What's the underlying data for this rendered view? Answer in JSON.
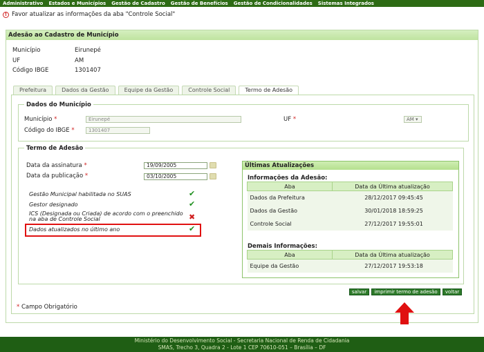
{
  "topnav": [
    "Administrativo",
    "Estados e Municípios",
    "Gestão de Cadastro",
    "Gestão de Benefícios",
    "Gestão de Condicionalidades",
    "Sistemas Integrados"
  ],
  "alert": "Favor atualizar as informações da aba \"Controle Social\"",
  "panel_title": "Adesão ao Cadastro de Município",
  "info": {
    "municipio_label": "Município",
    "municipio": "Eirunepé",
    "uf_label": "UF",
    "uf": "AM",
    "ibge_label": "Código IBGE",
    "ibge": "1301407"
  },
  "tabs": [
    "Prefeitura",
    "Dados da Gestão",
    "Equipe da Gestão",
    "Controle Social",
    "Termo de Adesão"
  ],
  "dados": {
    "legend": "Dados do Município",
    "municipio_label": "Município",
    "municipio_value": "Eirunepé",
    "uf_label": "UF",
    "uf_value": "AM",
    "ibge_label": "Código do IBGE",
    "ibge_value": "1301407",
    "required_mark": "*"
  },
  "termo": {
    "legend": "Termo de Adesão",
    "assinatura_label": "Data da assinatura",
    "assinatura_value": "19/09/2005",
    "publicacao_label": "Data da publicação",
    "publicacao_value": "03/10/2005",
    "checks": [
      "Gestão Municipal habilitada no SUAS",
      "Gestor designado",
      "ICS (Designada ou Criada) de acordo com o preenchido na aba de Controle Social",
      "Dados atualizados no último ano"
    ]
  },
  "ultimas": {
    "title": "Últimas Atualizações",
    "info_title": "Informações da Adesão:",
    "col_aba": "Aba",
    "col_data": "Data da Última atualização",
    "rows": [
      [
        "Dados da Prefeitura",
        "28/12/2017 09:45:45"
      ],
      [
        "Dados da Gestão",
        "30/01/2018 18:59:25"
      ],
      [
        "Controle Social",
        "27/12/2017 19:55:01"
      ]
    ],
    "demais_title": "Demais Informações:",
    "demais_rows": [
      [
        "Equipe da Gestão",
        "27/12/2017 19:53:18"
      ]
    ]
  },
  "buttons": {
    "salvar": "salvar",
    "imprimir": "imprimir termo de adesão",
    "voltar": "voltar"
  },
  "campo_obrigatorio": "Campo Obrigatório",
  "footer": {
    "line1": "Ministério do Desenvolvimento Social - Secretaria Nacional de Renda de Cidadania",
    "line2": "SMAS, Trecho 3, Quadra 2 - Lote 1 CEP 70610-051 – Brasília – DF"
  },
  "colors": {
    "nav": "#2d6b14",
    "accent": "#bcd9a8",
    "alert": "#d02020",
    "arrow": "#e01010"
  }
}
